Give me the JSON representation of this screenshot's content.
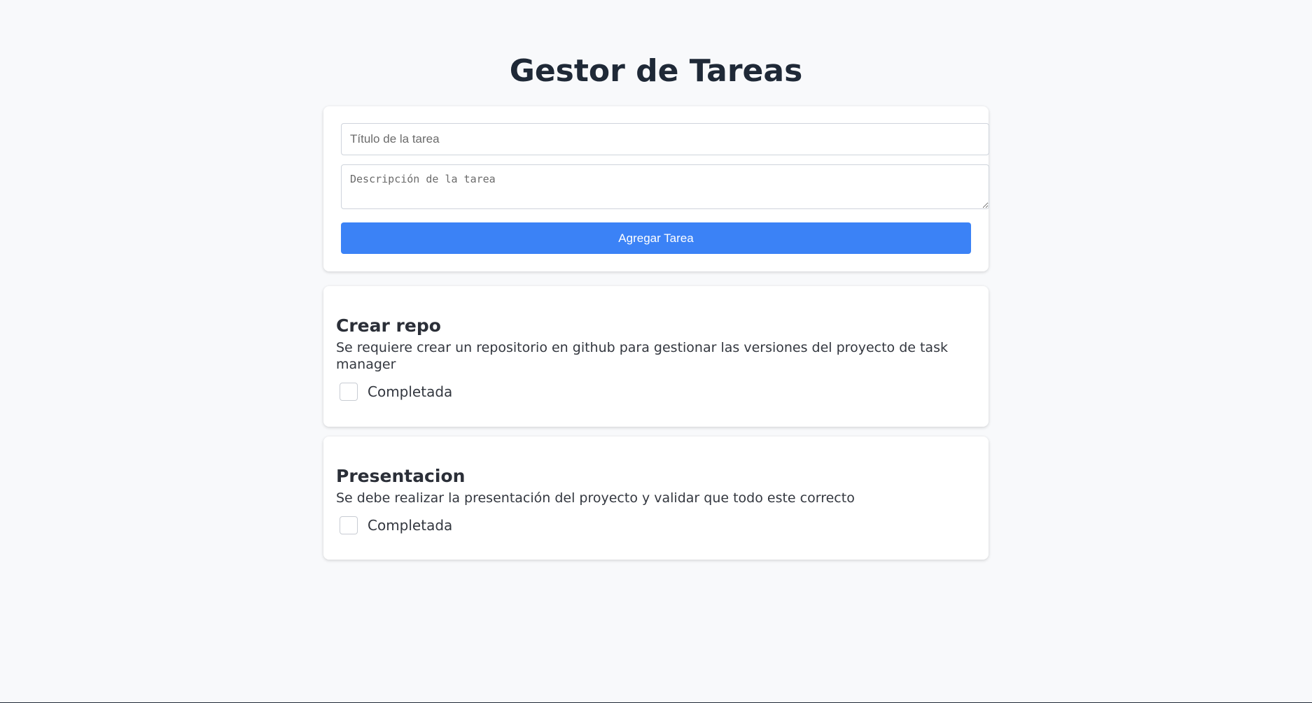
{
  "app": {
    "title": "Gestor de Tareas"
  },
  "form": {
    "title_placeholder": "Título de la tarea",
    "title_value": "",
    "description_placeholder": "Descripción de la tarea",
    "description_value": "",
    "add_button_label": "Agregar Tarea"
  },
  "tasks": [
    {
      "title": "Crear repo",
      "description": "Se requiere crear un repositorio en github para gestionar las versiones del proyecto de task manager",
      "completed_label": "Completada",
      "completed": false
    },
    {
      "title": "Presentacion",
      "description": "Se debe realizar la presentación del proyecto y validar que todo este correcto",
      "completed_label": "Completada",
      "completed": false
    }
  ],
  "colors": {
    "background": "#f8f9fb",
    "accent": "#3b82f6",
    "heading": "#1f2937"
  }
}
